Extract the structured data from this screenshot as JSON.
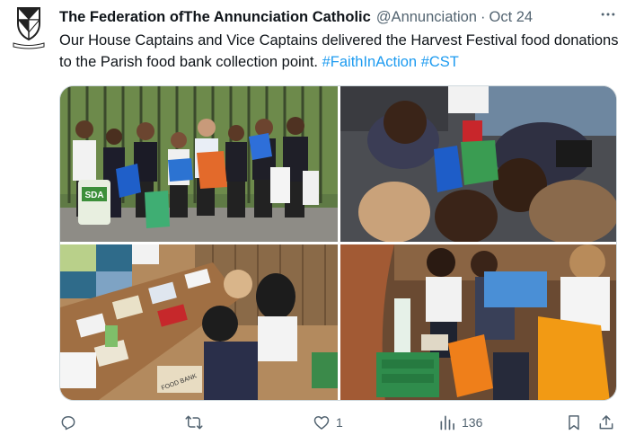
{
  "tweet": {
    "display_name": "The Federation ofThe Annunciation Catholic",
    "handle": "@Annunciation",
    "separator": "·",
    "date": "Oct 24",
    "more_icon": "more-icon",
    "text_main": "Our House Captains and Vice Captains delivered the Harvest Festival food donations to the Parish food bank collection point. ",
    "hashtags": [
      "#FaithInAction",
      "#CST"
    ]
  },
  "avatar": {
    "icon": "school-crest-icon",
    "motto": "VERITAS"
  },
  "photo_text": {
    "bag_label": "SDA",
    "box_label": "FOOD BANK"
  },
  "actions": {
    "reply_icon": "reply-icon",
    "repost_icon": "repost-icon",
    "like_icon": "heart-icon",
    "like_count": "1",
    "views_icon": "views-icon",
    "views_count": "136",
    "bookmark_icon": "bookmark-icon",
    "share_icon": "share-icon"
  },
  "colors": {
    "text": "#0f1419",
    "secondary": "#536471",
    "accent": "#1d9bf0",
    "border": "#cfd9de"
  }
}
